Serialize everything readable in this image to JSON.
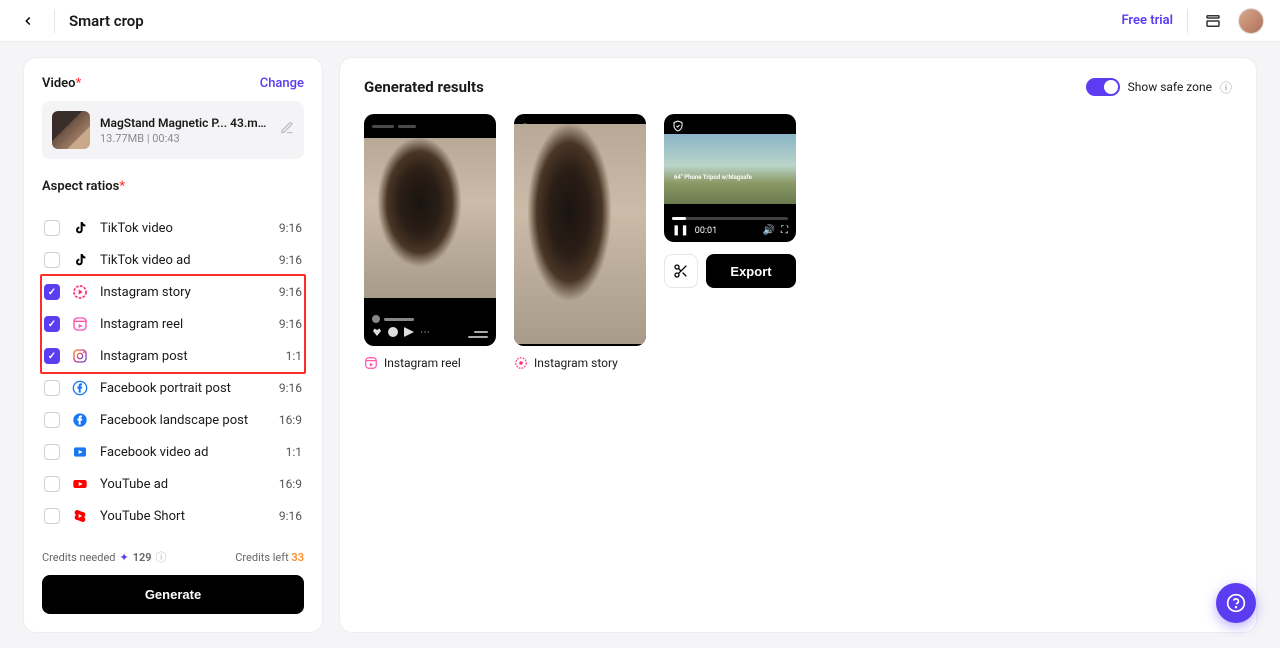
{
  "header": {
    "title": "Smart crop",
    "free_trial": "Free trial"
  },
  "sidebar": {
    "video_label": "Video",
    "change": "Change",
    "file_name": "MagStand Magnetic P... 43.mp4",
    "file_meta": "13.77MB  |  00:43",
    "aspect_label": "Aspect ratios",
    "ratios": [
      {
        "label": "TikTok video",
        "ratio": "9:16",
        "checked": false,
        "icon": "tiktok"
      },
      {
        "label": "TikTok video ad",
        "ratio": "9:16",
        "checked": false,
        "icon": "tiktok"
      },
      {
        "label": "Instagram story",
        "ratio": "9:16",
        "checked": true,
        "icon": "ig-story"
      },
      {
        "label": "Instagram reel",
        "ratio": "9:16",
        "checked": true,
        "icon": "ig-reel"
      },
      {
        "label": "Instagram post",
        "ratio": "1:1",
        "checked": true,
        "icon": "ig-post"
      },
      {
        "label": "Facebook portrait post",
        "ratio": "9:16",
        "checked": false,
        "icon": "fb-p"
      },
      {
        "label": "Facebook landscape post",
        "ratio": "16:9",
        "checked": false,
        "icon": "fb"
      },
      {
        "label": "Facebook video ad",
        "ratio": "1:1",
        "checked": false,
        "icon": "fbv"
      },
      {
        "label": "YouTube ad",
        "ratio": "16:9",
        "checked": false,
        "icon": "yt"
      },
      {
        "label": "YouTube Short",
        "ratio": "9:16",
        "checked": false,
        "icon": "yts"
      }
    ],
    "credits_needed_label": "Credits needed",
    "credits_needed_value": "129",
    "credits_left_label": "Credits left",
    "credits_left_value": "33",
    "generate": "Generate"
  },
  "content": {
    "title": "Generated results",
    "safe_zone": "Show safe zone",
    "results": [
      {
        "label": "Instagram reel"
      },
      {
        "label": "Instagram story"
      }
    ],
    "overlay_text": "64\" Phone Tripod w/Magsafe",
    "player_time": "00:01",
    "export": "Export"
  }
}
